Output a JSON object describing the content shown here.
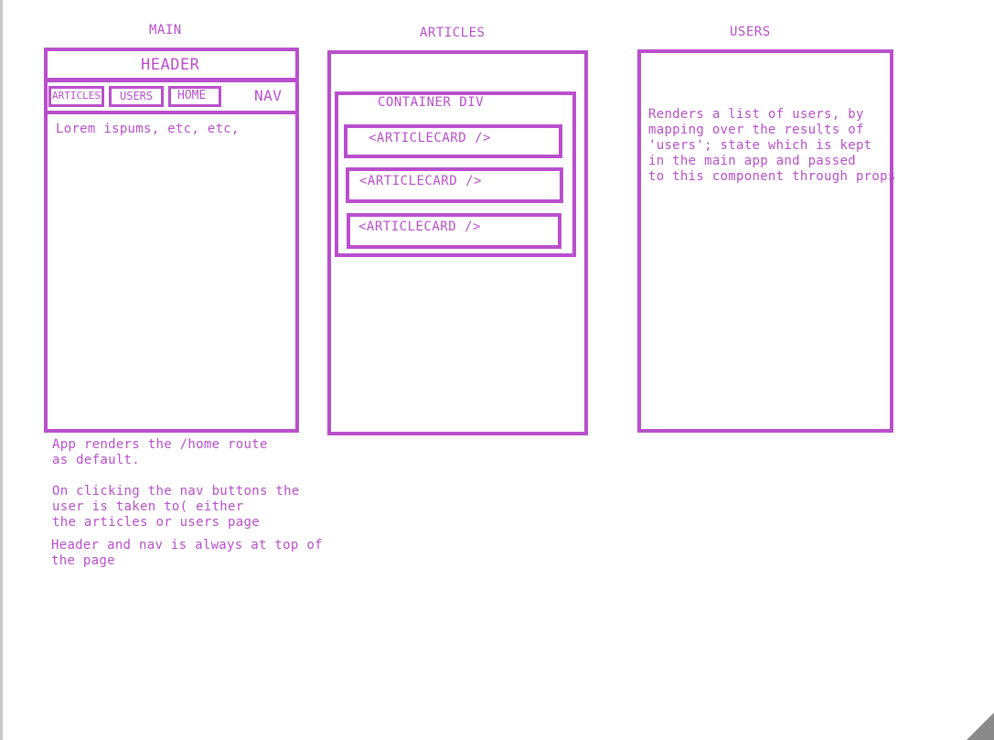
{
  "columns": {
    "main": {
      "label": "MAIN"
    },
    "articles": {
      "label": "ARTICLES"
    },
    "users": {
      "label": "USERS"
    }
  },
  "main": {
    "header": "HEADER",
    "nav_label": "NAV",
    "nav_buttons": [
      "ARTICLES",
      "USERS",
      "HOME"
    ],
    "body_text": "Lorem ispums, etc, etc,"
  },
  "articles": {
    "container_label": "CONTAINER  DIV",
    "cards": [
      "<ARTICLECARD />",
      "<ARTICLECARD />",
      "<ARTICLECARD />"
    ]
  },
  "users": {
    "description": "Renders a list of users, by\nmapping over the results of\n'users'; state which is kept\nin the main app and passed\nto this component through props"
  },
  "notes": [
    "App renders the /home route\nas default.",
    "On clicking the nav buttons the\nuser is taken to( either\nthe articles or users page",
    "Header and nav is always at top of\nthe page"
  ],
  "colors": {
    "stroke": "#b94fcc",
    "background": "#ffffff"
  }
}
